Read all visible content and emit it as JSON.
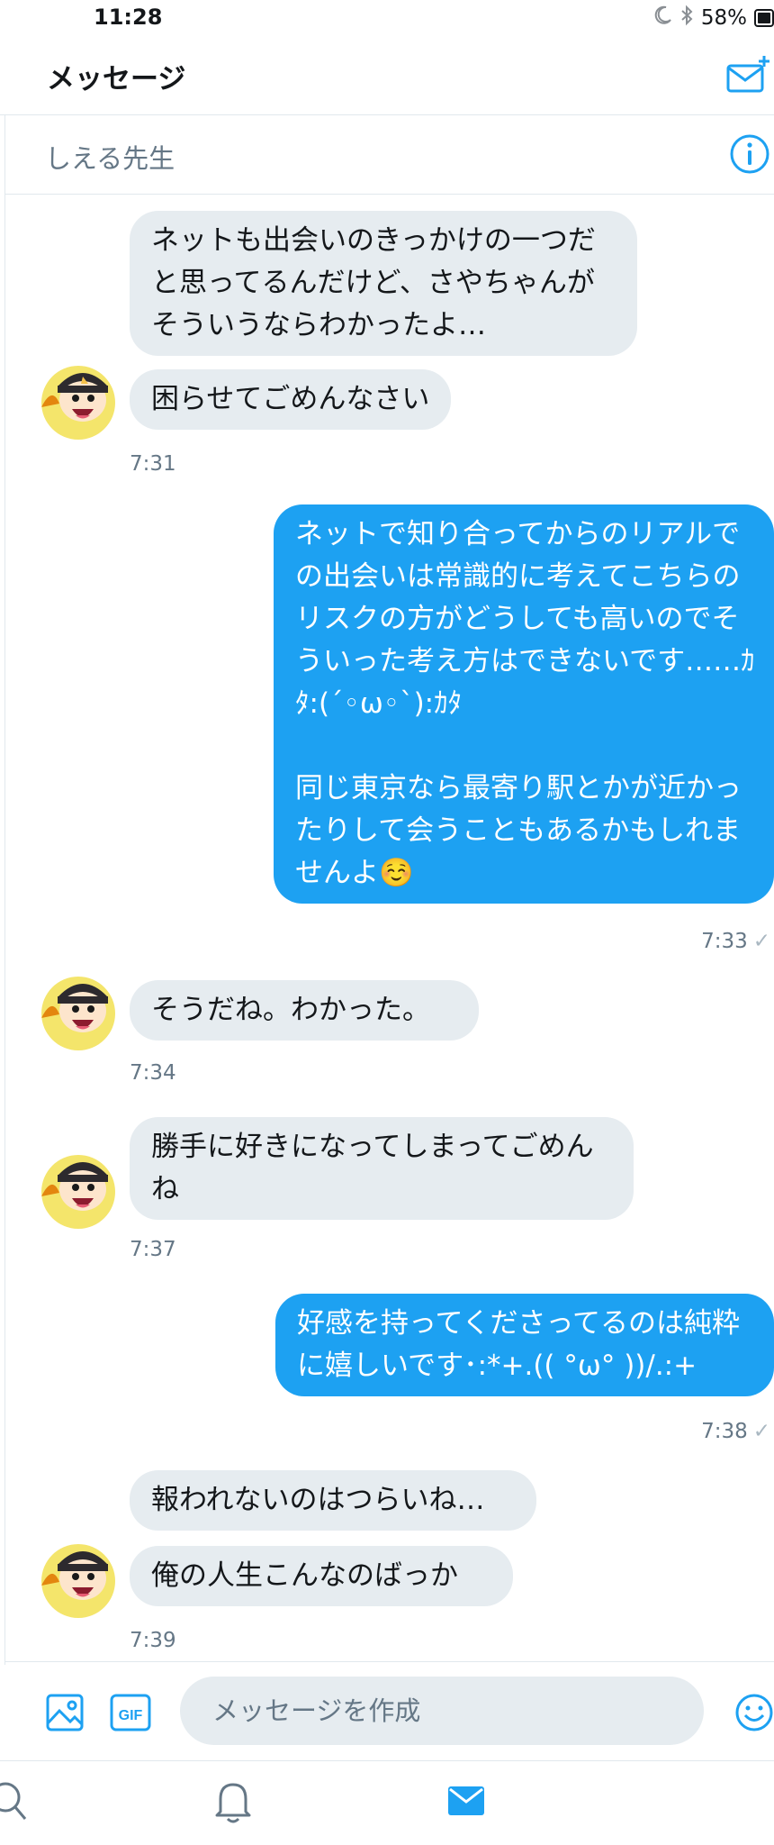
{
  "status": {
    "time": "11:28",
    "battery": "58%"
  },
  "header": {
    "title": "メッセージ"
  },
  "conversation": {
    "name": "しえる先生"
  },
  "messages": [
    {
      "dir": "in",
      "text": "ネットも出会いのきっかけの一つだと思ってるんだけど、さやちゃんがそういうならわかったよ…"
    },
    {
      "dir": "in",
      "text": "困らせてごめんなさい"
    },
    {
      "time": "7:31"
    },
    {
      "dir": "out",
      "text": "ネットで知り合ってからのリアルでの出会いは常識的に考えてこちらのリスクの方がどうしても高いのでそういった考え方はできないです……ｶﾀ:(´◦ω◦`):ｶﾀ\n\n同じ東京なら最寄り駅とかが近かったりして会うこともあるかもしれませんよ☺️"
    },
    {
      "time": "7:33"
    },
    {
      "dir": "in",
      "text": "そうだね。わかった。"
    },
    {
      "time": "7:34"
    },
    {
      "dir": "in",
      "text": "勝手に好きになってしまってごめんね"
    },
    {
      "time": "7:37"
    },
    {
      "dir": "out",
      "text": "好感を持ってくださってるのは純粋に嬉しいです･:*+.(( °ω° ))/.:+"
    },
    {
      "time": "7:38"
    },
    {
      "dir": "in",
      "text": "報われないのはつらいね…"
    },
    {
      "dir": "in",
      "text": "俺の人生こんなのばっか"
    },
    {
      "time": "7:39"
    }
  ],
  "composer": {
    "placeholder": "メッセージを作成",
    "gif_label": "GIF"
  },
  "colors": {
    "accent": "#1da1f2",
    "incoming_bubble": "#e6ecf0",
    "text": "#14171a",
    "muted": "#657786"
  },
  "icons": [
    "moon-icon",
    "bluetooth-icon",
    "battery-icon",
    "compose-message-icon",
    "info-icon",
    "image-icon",
    "gif-icon",
    "emoji-icon",
    "search-icon",
    "notifications-icon",
    "messages-icon"
  ]
}
